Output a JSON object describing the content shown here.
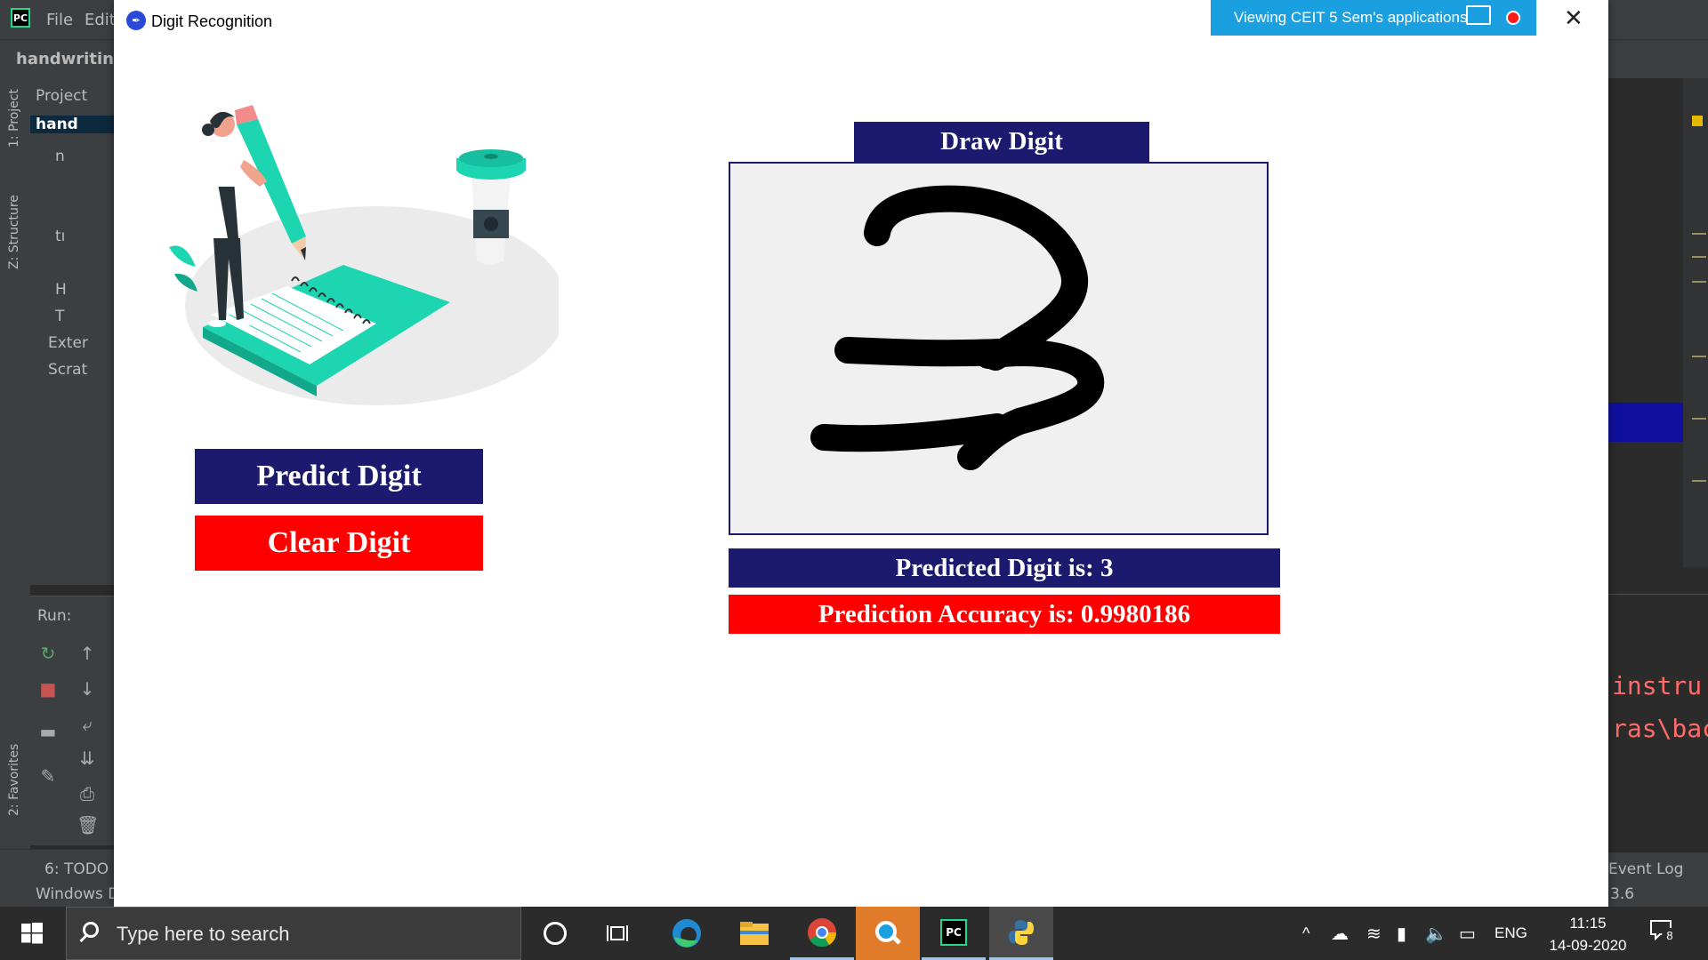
{
  "ide": {
    "menu": [
      "File",
      "Edit"
    ],
    "project_name": "handwriting_",
    "left_tabs": [
      "1: Project",
      "Z: Structure",
      "2: Favorites"
    ],
    "project_header": "Project",
    "tree": [
      "hand",
      "n",
      "tı",
      "H",
      "T",
      "Exter",
      "Scrat"
    ],
    "run_label": "Run:",
    "bottom_items": [
      "6: TODO",
      "Windows D",
      "Event Log",
      "3.6"
    ],
    "console_lines": [
      "instru",
      "ras\\bac"
    ]
  },
  "window": {
    "title": "Digit Recognition",
    "share_banner": "Viewing CEIT 5 Sem's applications"
  },
  "app": {
    "predict_button": "Predict Digit",
    "clear_button": "Clear Digit",
    "draw_header": "Draw Digit",
    "predicted_text": "Predicted Digit is: 3",
    "accuracy_text": "Prediction Accuracy is: 0.9980186"
  },
  "taskbar": {
    "search_placeholder": "Type here to search",
    "language": "ENG",
    "time": "11:15",
    "date": "14-09-2020",
    "notification_count": "8"
  },
  "colors": {
    "navy": "#1b1a6e",
    "red": "#ff0000",
    "teal": "#1dd6b1",
    "banner_blue": "#1aa0e0"
  }
}
